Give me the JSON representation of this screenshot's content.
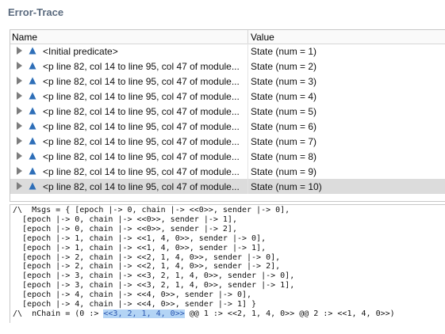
{
  "panel": {
    "title": "Error-Trace"
  },
  "tree": {
    "columns": {
      "name": "Name",
      "value": "Value"
    },
    "rows": [
      {
        "name": "<Initial predicate>",
        "value": "State (num = 1)"
      },
      {
        "name": "<p line 82, col 14 to line 95, col 47 of module...",
        "value": "State (num = 2)"
      },
      {
        "name": "<p line 82, col 14 to line 95, col 47 of module...",
        "value": "State (num = 3)"
      },
      {
        "name": "<p line 82, col 14 to line 95, col 47 of module...",
        "value": "State (num = 4)"
      },
      {
        "name": "<p line 82, col 14 to line 95, col 47 of module...",
        "value": "State (num = 5)"
      },
      {
        "name": "<p line 82, col 14 to line 95, col 47 of module...",
        "value": "State (num = 6)"
      },
      {
        "name": "<p line 82, col 14 to line 95, col 47 of module...",
        "value": "State (num = 7)"
      },
      {
        "name": "<p line 82, col 14 to line 95, col 47 of module...",
        "value": "State (num = 8)"
      },
      {
        "name": "<p line 82, col 14 to line 95, col 47 of module...",
        "value": "State (num = 9)"
      },
      {
        "name": "<p line 82, col 14 to line 95, col 47 of module...",
        "value": "State (num = 10)"
      }
    ],
    "selected_index": 9
  },
  "detail": {
    "lines": [
      "/\\  Msgs = { [epoch |-> 0, chain |-> <<0>>, sender |-> 0],",
      "  [epoch |-> 0, chain |-> <<0>>, sender |-> 1],",
      "  [epoch |-> 0, chain |-> <<0>>, sender |-> 2],",
      "  [epoch |-> 1, chain |-> <<1, 4, 0>>, sender |-> 0],",
      "  [epoch |-> 1, chain |-> <<1, 4, 0>>, sender |-> 1],",
      "  [epoch |-> 2, chain |-> <<2, 1, 4, 0>>, sender |-> 0],",
      "  [epoch |-> 2, chain |-> <<2, 1, 4, 0>>, sender |-> 2],",
      "  [epoch |-> 3, chain |-> <<3, 2, 1, 4, 0>>, sender |-> 0],",
      "  [epoch |-> 3, chain |-> <<3, 2, 1, 4, 0>>, sender |-> 1],",
      "  [epoch |-> 4, chain |-> <<4, 0>>, sender |-> 0],",
      "  [epoch |-> 4, chain |-> <<4, 0>>, sender |-> 1] }"
    ],
    "last_line": {
      "prefix": "/\\  nChain = (0 :> ",
      "highlight": "<<3, 2, 1, 4, 0>>",
      "suffix": " @@ 1 :> <<2, 1, 4, 0>> @@ 2 :> <<1, 4, 0>>)"
    }
  },
  "colors": {
    "title": "#5a6a7e",
    "selected_row": "#dcdcdc",
    "state_icon": "#2f6fb8",
    "highlight_bg": "#b3d4f5"
  },
  "icons": {
    "expand": "triangle-right-icon",
    "state": "state-triangle-icon"
  }
}
